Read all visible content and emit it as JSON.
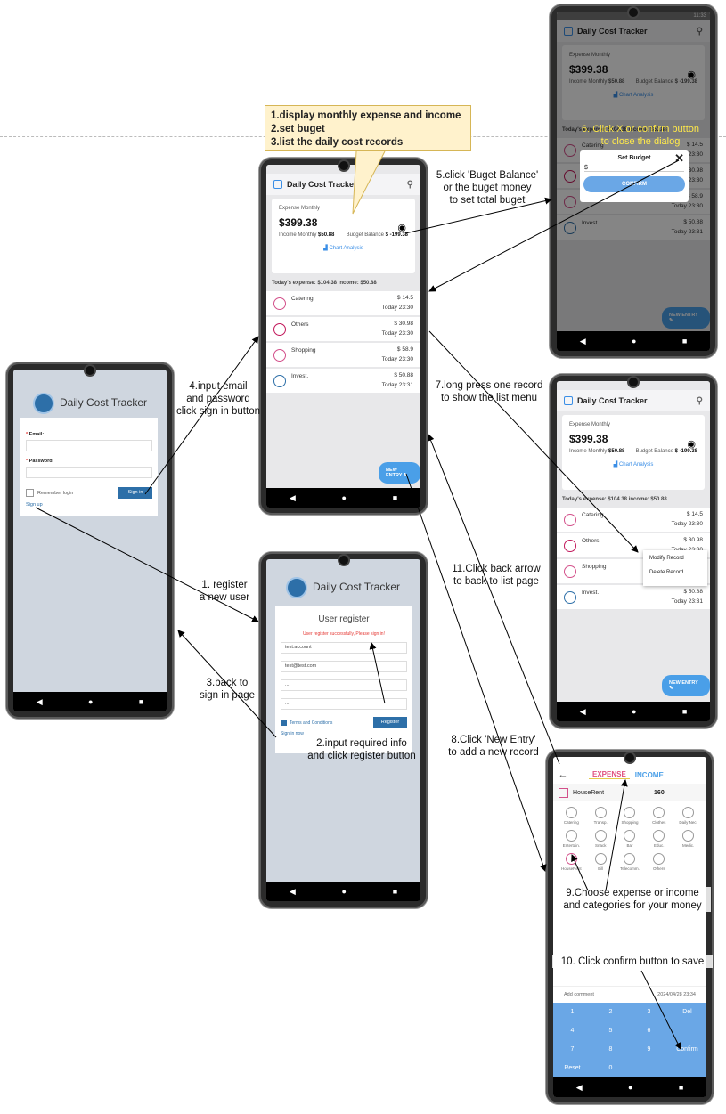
{
  "app_title": "Daily Cost Tracker",
  "callout": {
    "lines": [
      "1.display monthly expense and income",
      "2.set buget",
      "3.list the daily cost records"
    ]
  },
  "steps": {
    "s1": [
      "1. register",
      "a new user"
    ],
    "s2": [
      "2.input required info",
      "and click register button"
    ],
    "s3": [
      "3.back to",
      "sign in page"
    ],
    "s4": [
      "4.input email",
      "and password",
      "click sign in button"
    ],
    "s5": [
      "5.click 'Buget Balance'",
      "or the buget money",
      "to set total buget"
    ],
    "s6": [
      "6. Click X or confirm button",
      "to close the dialog"
    ],
    "s7": [
      "7.long press one record",
      "to show the list menu"
    ],
    "s8": [
      "8.Click 'New Entry'",
      "to add a new record"
    ],
    "s9": [
      "9.Choose expense or income",
      "and categories for your money"
    ],
    "s10": [
      "10. Click confirm button to save"
    ],
    "s11": [
      "11.Click back arrow",
      "to back to list page"
    ]
  },
  "signin": {
    "email_label": "Email:",
    "password_label": "Password:",
    "remember": "Remember login",
    "signin_button": "Sign in",
    "signup_link": "Sign up"
  },
  "register": {
    "title": "User register",
    "success_msg": "User register successfully, Please sign in!",
    "account": "test.account",
    "email": "test@test.com",
    "pw1": "....",
    "pw2": "....",
    "terms": "Terms and Conditions",
    "register_button": "Register",
    "signin_link": "Sign in now"
  },
  "summary": {
    "expense_label": "Expense Monthly",
    "expense": "$399.38",
    "income_label": "Income Monthly",
    "income": "$50.88",
    "balance_label": "Budget Balance",
    "balance": "$ -199.38",
    "chart_link": "Chart Analysis"
  },
  "today_line": "Today's expense: $104.38 income: $50.88",
  "records": [
    {
      "name": "Catering",
      "amount": "$ 14.5",
      "time": "Today 23:30",
      "color": "#d3508a"
    },
    {
      "name": "Others",
      "amount": "$ 30.98",
      "time": "Today 23:30",
      "color": "#c2185b"
    },
    {
      "name": "Shopping",
      "amount": "$ 58.9",
      "time": "Today 23:30",
      "color": "#d3508a"
    },
    {
      "name": "Invest.",
      "amount": "$ 50.88",
      "time": "Today 23:31",
      "color": "#2d6fa8"
    }
  ],
  "new_entry": "NEW ENTRY",
  "dialog": {
    "title": "Set Budget",
    "currency": "$",
    "confirm": "CONFIRM"
  },
  "status_time": "11:33",
  "context_menu": [
    "Modify Record",
    "Delete Record"
  ],
  "entry": {
    "tab_expense": "EXPENSE",
    "tab_income": "INCOME",
    "selected_category": "HouseRent",
    "value": "160",
    "categories": [
      "Catering",
      "Transp.",
      "Shopping",
      "Clothes",
      "Daily Nec.",
      "Entertain.",
      "Snack",
      "Bar",
      "Educ.",
      "Medic.",
      "HouseRent",
      "Bill",
      "Telecomm.",
      "Others"
    ],
    "comment_placeholder": "Add comment",
    "datetime": "2024/04/28 23:34",
    "keys": [
      "1",
      "2",
      "3",
      "Del",
      "4",
      "5",
      "6",
      "",
      "7",
      "8",
      "9",
      "Confirm",
      "Reset",
      "0",
      ".",
      ""
    ]
  },
  "nav": {
    "back": "◀",
    "home": "●",
    "recent": "■"
  }
}
